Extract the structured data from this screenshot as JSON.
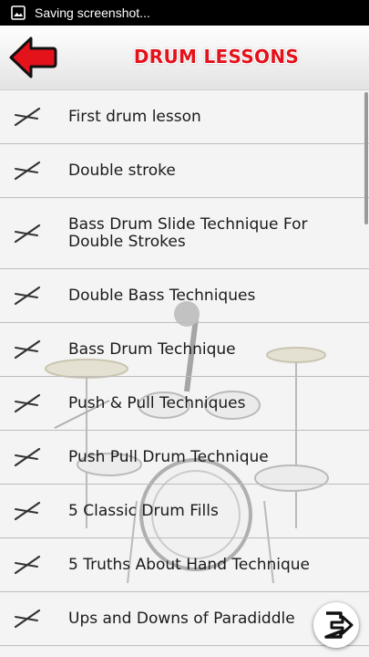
{
  "status_bar": {
    "text": "Saving screenshot..."
  },
  "header": {
    "title": "DRUM LESSONS"
  },
  "lessons": [
    {
      "label": "First drum lesson"
    },
    {
      "label": "Double stroke"
    },
    {
      "label": "Bass Drum Slide Technique For Double Strokes"
    },
    {
      "label": "Double Bass Techniques"
    },
    {
      "label": "Bass Drum Technique"
    },
    {
      "label": "Push & Pull Techniques"
    },
    {
      "label": "Push Pull Drum Technique"
    },
    {
      "label": "5 Classic Drum Fills"
    },
    {
      "label": "5 Truths About Hand Technique"
    },
    {
      "label": "Ups and Downs of Paradiddle"
    }
  ],
  "colors": {
    "title": "#e3121b",
    "back_arrow": "#e3121b"
  }
}
